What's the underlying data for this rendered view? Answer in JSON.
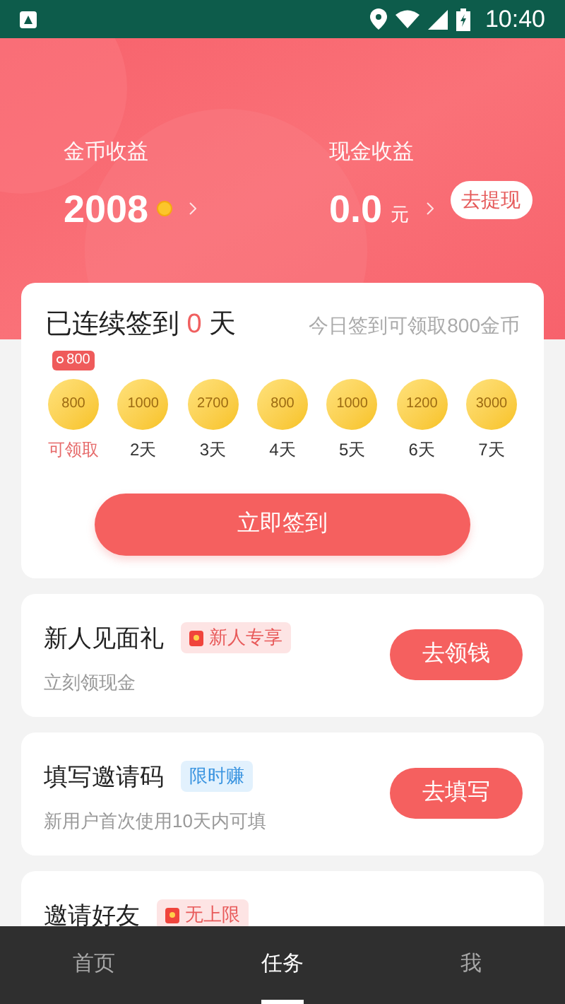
{
  "status_bar": {
    "time": "10:40"
  },
  "earnings": [
    {
      "label": "金币收益",
      "value": "2008",
      "kind": "coin"
    },
    {
      "label": "现金收益",
      "value": "0.0",
      "unit": "元",
      "kind": "cash",
      "button": "去提现"
    }
  ],
  "checkin": {
    "title_before": "已连续签到",
    "count": "0",
    "title_after": "天",
    "hint": "今日签到可领取800金币",
    "today_badge": "800",
    "days": [
      {
        "amount": "800",
        "label": "可领取",
        "selected": true
      },
      {
        "amount": "1000",
        "label": "2天",
        "selected": false
      },
      {
        "amount": "2700",
        "label": "3天",
        "selected": false
      },
      {
        "amount": "800",
        "label": "4天",
        "selected": false
      },
      {
        "amount": "1000",
        "label": "5天",
        "selected": false
      },
      {
        "amount": "1200",
        "label": "6天",
        "selected": false
      },
      {
        "amount": "3000",
        "label": "7天",
        "selected": false
      }
    ],
    "button": "立即签到"
  },
  "tasks": [
    {
      "title": "新人见面礼",
      "tag": {
        "label": "新人专享",
        "kind": "red-packet"
      },
      "subtitle": "立刻领现金",
      "button": "去领钱"
    },
    {
      "title": "填写邀请码",
      "tag": {
        "label": "限时赚",
        "kind": "limited"
      },
      "subtitle": "新用户首次使用10天内可填",
      "button": "去填写"
    },
    {
      "title": "邀请好友",
      "tag": {
        "label": "无上限",
        "kind": "red-packet"
      }
    }
  ],
  "nav": [
    {
      "label": "首页",
      "selected": false
    },
    {
      "label": "任务",
      "selected": true
    },
    {
      "label": "我",
      "selected": false
    }
  ]
}
